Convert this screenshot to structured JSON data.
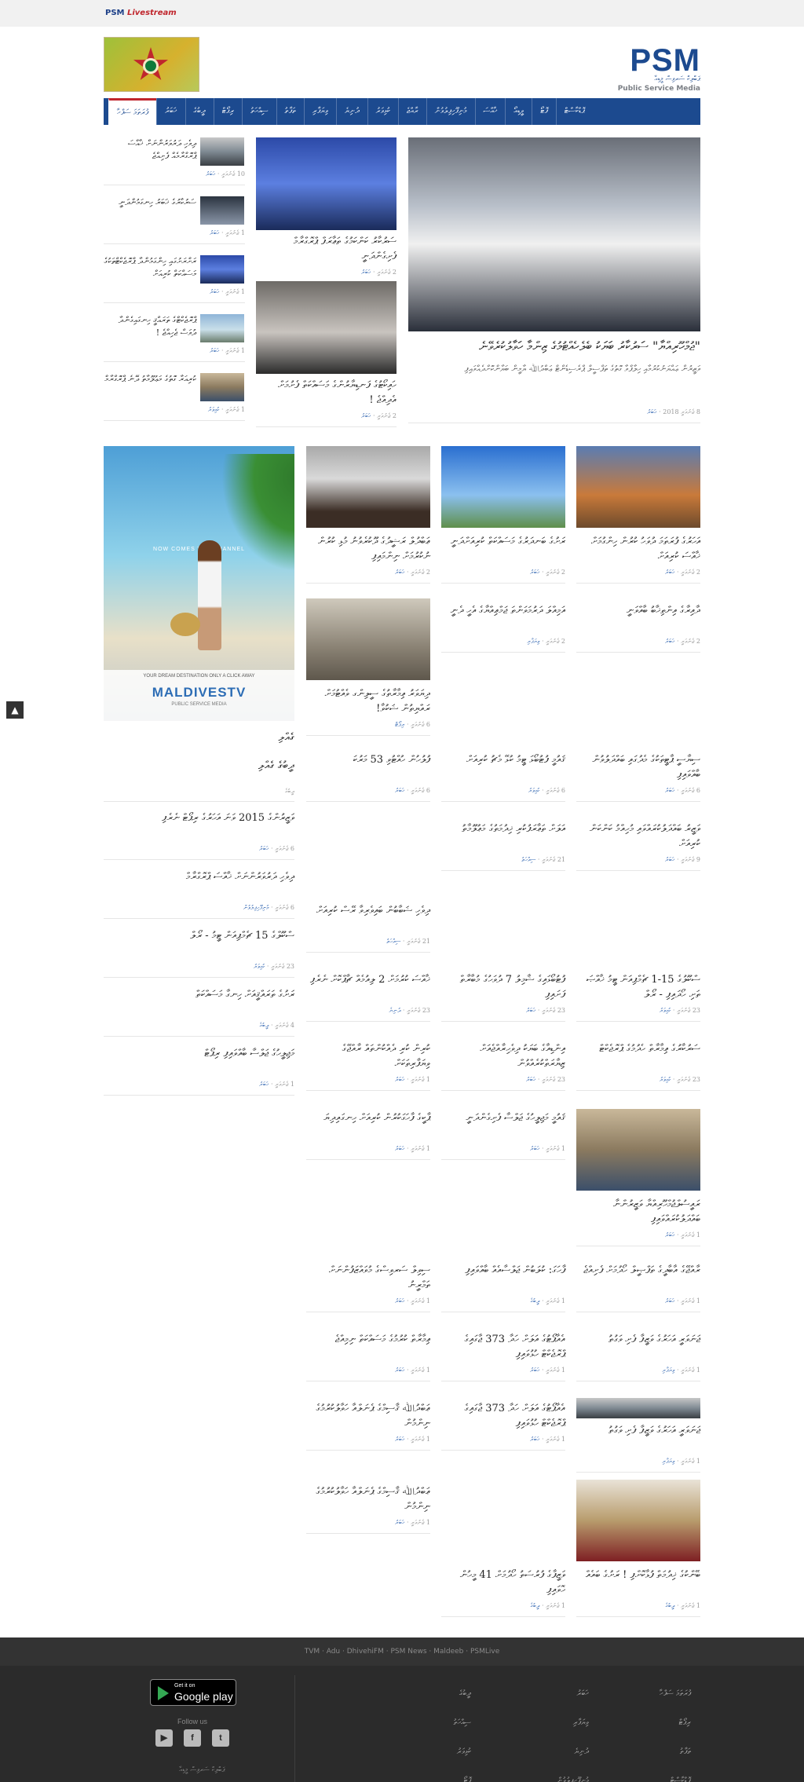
{
  "topbar": {
    "livestream_psm": "PSM",
    "livestream_live": "Livestream"
  },
  "logo": {
    "name": "PSM",
    "thaana": "ޕަބްލިކް ސަރވިސް މީޑިއާ",
    "english": "Public Service Media"
  },
  "ad_banner": {
    "text": "MALDIVES JUBILEE"
  },
  "nav": {
    "items": [
      "ފުރަތަމަ ސަފްހާ",
      "ޚަބަރު",
      "ދީބުގެ",
      "ރިޕޯޓް",
      "ސިއްހަތު",
      "ތަފާތު",
      "ވިޔަފާރި",
      "ދުނިޔެ",
      "ކުޅިވަރު",
      "ރާއްޖެ",
      "މުނިފޫހިފިލުވުން",
      "ޚާއްސަ",
      "ވީޑިއޯ",
      "ފޮޓޯ",
      "ޕޮޑްކާސްޓް"
    ],
    "active_index": 0
  },
  "featured": {
    "headline": "\"ޖުމްހޫރިއްޔާ\" ސަރުކާރު ބަޔަކު ބެލެހެއްޓުމުގެ ޒިންމާ ހަވާލުކުރެވޭނެ",
    "summary": "ވަޒީރުން ޢައްޔަނުކުރުމާއި ހިލާފްވާ ގޮތުގެ ތަފްސީލް ޕްރެސިޑެންޓް ޢަބްދުﷲ ޔާމީން ބަޔާންކޮށްދެއްވައިފި",
    "date": "8 ޖެނުއަރީ 2018",
    "category": "ޚަބަރު"
  },
  "mid_stories": [
    {
      "headline": "ސަރުކާރު ކަންކަމުގެ ތަޢާރަފް ޕްރޮގްރާމް ފެށިގެންދަނީ",
      "date": "2 ޖެނުއަރީ",
      "category": "ޚަބަރު"
    },
    {
      "headline": "ހައިކޯޓުގެ ފަނޑިޔާރުންގެ މަސައްކަތް ފެށުމަށް އެދިއްޖެ !",
      "date": "2 ޖެނުއަރީ",
      "category": "ޚަބަރު"
    }
  ],
  "left_list": [
    {
      "headline": "ދިވެހި ދަރުވަރުންނަށް ޚާއްސަ ޕްރޮގްރާމެއް ފެށިއްޖެ",
      "date": "10 ޖެނުއަރީ",
      "category": "ޚަބަރު"
    },
    {
      "headline": "ސަރުކާރުގެ ޚަބަރު ހިނގަމުންދަނީ",
      "date": "1 ޖެނުއަރީ",
      "category": "ޚަބަރު"
    },
    {
      "headline": "ރަށްރަށުގައި ހިންގަމުންދާ ޕްރޮޖެކްޓްތަކުގެ މަސައްކަތް ކުރިއަށް",
      "date": "1 ޖެނުއަރީ",
      "category": "ޚަބަރު"
    },
    {
      "headline": "ޕްރޮޖެކްޓްގެ ތަރައްޤީ ހިނގައިގެންދާ ދުވަސް ޖެހިއްޖެ !",
      "date": "1 ޖެނުއަރީ",
      "category": "ޚަބަރު"
    },
    {
      "headline": "ކުރިއަރާ ގޮތުގެ މަޢުލޫމާތު ދޭނެ ޕްރޮގްރާމް",
      "date": "1 ޖެނުއަރީ",
      "category": "ކުޅިވަރު"
    }
  ],
  "grid_row1": [
    {
      "headline": "އަހަރުގެ ފުރަތަމަ ދުވަހު ކުރުން ހިންގުމަށް ޚާއްސަ ކުރިއަށް",
      "date": "2 ޖެނުއަރީ",
      "category": "ޚަބަރު"
    },
    {
      "headline": "ރަށުގެ ބަނދަރުގެ މަސައްކަތް ކުރިއަށްދަނީ",
      "date": "2 ޖެނުއަރީ",
      "category": "ޚަބަރު"
    },
    {
      "headline": "ޢަބްދުލް ރަޝީދުގެ ދޫކުރެވުނު މުޅި ކުރުން ނުކުރުމަށް ނިންމައިފި",
      "date": "2 ޖެނުއަރީ",
      "category": "ޚަބަރު"
    }
  ],
  "grid_row2": [
    {
      "headline": "ދާއިރާގެ އިންތިޚާބު ބާއްވަނީ",
      "date": "2 ޖެނުއަރީ",
      "category": "ޚަބަރު"
    },
    {
      "headline": "އަމިއްލަ ދަރުމަވަންތަ ޖަމްޢިއްޔާގެ އެހީ ދެނީ",
      "date": "2 ޖެނުއަރީ",
      "category": "ވިޔަފާރި"
    },
    {
      "headline": "ދިޔަވަރު ޢިމާރާތުގެ ސީލިންގ ވެއްޓުމަށް ރައްޔިތުން ޝަކުވާ!",
      "date": "6 ޖެނުއަރީ",
      "category": "ރިޕޯޓް"
    }
  ],
  "grid_row3": [
    {
      "headline": "ސިޔާސީ ޕާޓީތަކުގެ މެދުގައި ބައްދަލުވުން ބާއްވައިފި",
      "date": "6 ޖެނުއަރީ",
      "category": "ޚަބަރު"
    },
    {
      "headline": "ޤައުމީ ފުޓުބޯޅަ ޓީމު ކުޅޭ މެޗު ކުރިއަށް",
      "date": "6 ޖެނުއަރީ",
      "category": "ކުޅިވަރު"
    },
    {
      "headline": "ފުލުހުން ހުއްޓުވި 53 މަރުކަ",
      "date": "6 ޖެނުއަރީ",
      "category": "ޚަބަރު"
    }
  ],
  "grid_row4": [
    {
      "headline": "ވަޒީރު ބައްދަލުކުރައްވައި މުހިއްމު ކަންކަން ކުރިއަށް",
      "date": "9 ޖެނުއަރީ",
      "category": "ޚަބަރު"
    },
    {
      "headline": "އަލަށް ތަޢާރަފުކުރި ޚިދުމަތުގެ މަޢުލޫމާތު",
      "date": "21 ޖެނުއަރީ",
      "category": "ސިއްހަތު"
    }
  ],
  "grid_row5": [
    {
      "headline": "ދިވެހި ޝަބާބުން ބައިވެރިވާ ރޭސް ކުރިއަށް",
      "date": "21 ޖެނުއަރީ",
      "category": "ސިއްހަތު"
    }
  ],
  "grid_row6": [
    {
      "headline": "ސްކޫލުގެ 15-1 ޗެމްޕިއަން ޓީމު ޚާއްޞަ ތަށި ހޯދައިފި - ރޯލް",
      "date": "23 ޖެނުއަރީ",
      "category": "ކުޅިވަރު"
    },
    {
      "headline": "ފުޓުބޯޅައިގެ ޝާމިލު 7 ދުވަހުގެ މުބާރާތް ފަށައިފި",
      "date": "23 ޖެނުއަރީ",
      "category": "ޚަބަރު"
    },
    {
      "headline": "ޚާއްސަ ކުރުމަށް 2 ލިއުމެއް ޗާޕްކޮށް ނެރެފި",
      "date": "23 ޖެނުއަރީ",
      "category": "ދުނިޔެ"
    }
  ],
  "grid_row7": [
    {
      "headline": "ސަރުކާރުގެ ޢިމާރާތް ހެދުމުގެ ޕްރޮޖެކްޓް",
      "date": "23 ޖެނުއަރީ",
      "category": "ކުޅިވަރު"
    },
    {
      "headline": "އިންޑިއާގެ ބަޔަކު ދިވެހިރާއްޖެއަށް ޒިޔާރަތްކުރެއްވުން",
      "date": "23 ޖެނުއަރީ",
      "category": "ޚަބަރު"
    },
    {
      "headline": "ކުރިން ކުރި ދެއްކުންތައް ރާއްޖޭގެ ވިޔަފާރިތަކަށް",
      "date": "1 ޖެނުއަރީ",
      "category": "ޚަބަރު"
    }
  ],
  "grid_row8": [
    {
      "headline": "ޤައުމީ މަޖިލީހުގެ ޖަލްސާ ފެށިގެންދަނީ",
      "date": "1 ޖެނުއަރީ",
      "category": "ޚަބަރު"
    },
    {
      "headline": "ޕާކީގެ ފާހަގަކުރުން ކުރިއަށް ހިނގައިދިޔަ",
      "date": "1 ޖެނުއަރީ",
      "category": "ޚަބަރު"
    }
  ],
  "grid_row9": [
    {
      "headline": "ރައީސުލްޖުމްހޫރިއްޔާ ވަޒީރުންނާ ބައްދަލުކުރައްވައިފި",
      "date": "1 ޖެނުއަރީ",
      "category": "ޚަބަރު"
    }
  ],
  "grid_row10": [
    {
      "headline": "ރާއްޖޭގެ އާބާދީގެ ތަފްޞީލް ހޯދުމަށް ފެށިއްޖެ",
      "date": "1 ޖެނުއަރީ",
      "category": "ޚަބަރު"
    },
    {
      "headline": "ފާހަގަ: ކުލަބުން ޖަލްސާއެއް ބާއްވައިފި",
      "date": "1 ޖެނުއަރީ",
      "category": "ދީބުގެ"
    },
    {
      "headline": "ސިވިލް ސަރވިސްގެ މުވައްޒަފުންނަށް ތަމްރީނު",
      "date": "1 ޖެނުއަރީ",
      "category": "ޚަބަރު"
    }
  ],
  "grid_row11": [
    {
      "headline": "ޖަނަވަރީ އަހަރުގެ ވަޒީފާ ފެށި ވަގުތު",
      "date": "1 ޖެނުއަރީ",
      "category": "ވިޔަފާރި"
    },
    {
      "headline": "އެއާޕޯޓުގެ އަލަށް ހަދާ 373 ޖާގައިގެ ޕްރޮޖެކްޓް ހުޅުވައިފި",
      "date": "1 ޖެނުއަރީ",
      "category": "ޚަބަރު"
    },
    {
      "headline": "ޢިމާރާތް ކުރުމުގެ މަސައްކަތް ނިމިއްޖެ",
      "date": "1 ޖެނުއަރީ",
      "category": "ޚަބަރު"
    }
  ],
  "grid_row12": [
    {
      "headline": "ޖަނަވަރީ އަހަރުގެ ވަޒީފާ ފެށި ވަގުތު",
      "date": "1 ޖެނުއަރީ",
      "category": "ވިޔަފާރި"
    },
    {
      "headline": "އެއާޕޯޓުގެ އަލަށް ހަދާ 373 ޖާގައިގެ ޕްރޮޖެކްޓް ހުޅުވައިފި",
      "date": "1 ޖެނުއަރީ",
      "category": "ޚަބަރު"
    },
    {
      "headline": "ޢަބްދުﷲ ޤާސިމްގެ ޕެނަލްއާ ހަވާލުކުރުމުގެ ނިންމުން",
      "date": "1 ޖެނުއަރީ",
      "category": "ޚަބަރު"
    }
  ],
  "grid_row13": [
    {
      "headline": "ޢަބްދުﷲ ޤާސިމްގެ ޕެނަލްއާ ހަވާލުކުރުމުގެ ނިންމުން",
      "date": "1 ޖެނުއަރީ",
      "category": "ޚަބަރު"
    }
  ],
  "grid_row14": [
    {
      "headline": "ބޭންކުގެ ޚިދުމަތް ފުޅާކޮށްފި ! ރަށުގެ ބައެއް",
      "date": "1 ޖެނުއަރީ",
      "category": "ދީބުގެ"
    },
    {
      "headline": "ވަޒީފާގެ ފުރުސަތު ހޯދުމަށް 41 މީހުން ހޮވައިފި",
      "date": "1 ޖެނުއަރީ",
      "category": "ދީބުގެ"
    }
  ],
  "sidebar": {
    "ad_tagline": "NOW COMES THE CHANNEL",
    "ad_caption": "YOUR DREAM DESTINATION ONLY A CLICK AWAY",
    "ad_brand": "MALDIVESTV",
    "ad_small": "PUBLIC SERVICE MEDIA",
    "section_title": "ގެއްލި",
    "section_sub": "ދީބުގެ ގެއްލި",
    "section_label": "ދީބުގެ",
    "items": [
      {
        "headline": "ވަޒީރުންގެ 2015 ވަނަ އަހަރުގެ ރިޕޯޓް ނެރެފި",
        "date": "6 ޖެނުއަރީ",
        "category": "ޚަބަރު"
      },
      {
        "headline": "ދިވެހި ދަރުވަރުންނަށް ޚާއްސަ ޕްރޮގްރާމް",
        "date": "6 ޖެނުއަރީ",
        "category": "މުނިފޫހިފިލުވުން"
      },
      {
        "headline": "ސްކޫލްގެ 15 ޗެމްޕިއަން ޓީމު - ރޯލް",
        "date": "23 ޖެނުއަރީ",
        "category": "ކުޅިވަރު"
      },
      {
        "headline": "ރަށުގެ ތަރައްޤީއަށް ހިނގާ މަސައްކަތް",
        "date": "4 ޖެނުއަރީ",
        "category": "ދީބުގެ"
      },
      {
        "headline": "މަޖިލީހުގެ ޖަލްސާ ބާއްވައިފި ރިޕޯޓް",
        "date": "1 ޖެނުއަރީ",
        "category": "ޚަބަރު"
      }
    ]
  },
  "footer": {
    "links": "TVM · Adu · DhivehiFM · PSM News · Maldeeb · PSMLive",
    "gplay_small": "Get it on",
    "gplay_big": "Google play",
    "follow": "Follow us",
    "copyright": "ޕަބްލިކް ސަރވިސް މީޑިއާ",
    "col1": [
      "ފުރަތަމަ ސަފްހާ",
      "ރިޕޯޓް",
      "ތަފާތު",
      "ޕޮޑްކާސްޓް"
    ],
    "col2": [
      "ޚަބަރު",
      "ވިޔަފާރި",
      "ދުނިޔެ",
      "މުނިފޫހިފިލުވުން"
    ],
    "col3": [
      "ދީބުގެ",
      "ސިއްހަތު",
      "ކުޅިވަރު",
      "ފޮޓޯ"
    ]
  }
}
